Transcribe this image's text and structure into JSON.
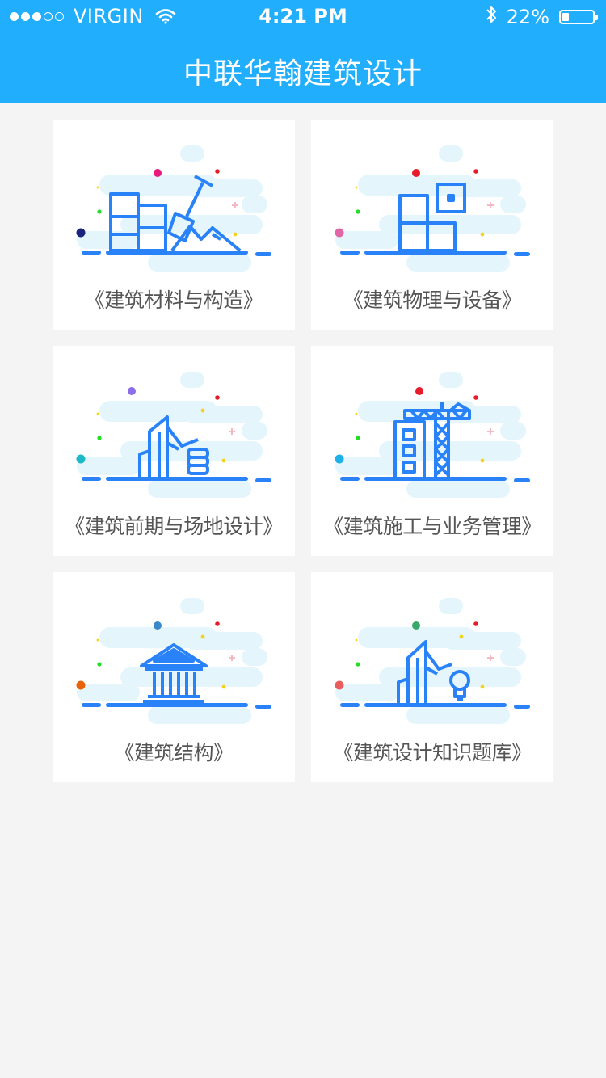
{
  "status_bar": {
    "carrier": "VIRGIN",
    "time": "4:21 PM",
    "battery": "22%",
    "battery_level": 0.22,
    "icons": [
      "signal-dots-icon",
      "wifi-icon",
      "bluetooth-icon",
      "battery-icon"
    ]
  },
  "header": {
    "title": "中联华翰建筑设计"
  },
  "colors": {
    "header": "#21aefc",
    "icon_blue": "#2a82f8",
    "cloud": "#e4f6fc"
  },
  "cards": [
    {
      "label": "《建筑材料与构造》",
      "icon": "bricks-shovel-icon",
      "accent": "#1a237e"
    },
    {
      "label": "《建筑物理与设备》",
      "icon": "blocks-icon",
      "accent": "#e066a8"
    },
    {
      "label": "《建筑前期与场地设计》",
      "icon": "buildings-server-icon",
      "accent": "#1eb8c8"
    },
    {
      "label": "《建筑施工与业务管理》",
      "icon": "crane-icon",
      "accent": "#1eb0e8"
    },
    {
      "label": "《建筑结构》",
      "icon": "temple-icon",
      "accent": "#e8620a"
    },
    {
      "label": "《建筑设计知识题库》",
      "icon": "building-bulb-icon",
      "accent": "#e85d5d"
    }
  ]
}
